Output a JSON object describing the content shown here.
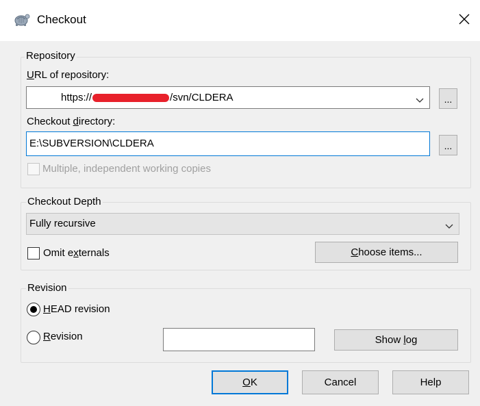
{
  "window": {
    "title": "Checkout",
    "close_label": "✕"
  },
  "repository": {
    "group_label": "Repository",
    "url_label_accel": "U",
    "url_label_rest": "RL of repository:",
    "url_value_prefix": "https://",
    "url_value_suffix": "/svn/CLDERA",
    "browse_label": "...",
    "dir_label_pre": "Checkout ",
    "dir_label_accel": "d",
    "dir_label_post": "irectory:",
    "dir_value": "E:\\SUBVERSION\\CLDERA",
    "multiple_label": "Multiple, independent working copies"
  },
  "depth": {
    "group_label": "Checkout Depth",
    "selected": "Fully recursive",
    "omit_pre": "Omit e",
    "omit_accel": "x",
    "omit_post": "ternals",
    "choose_accel": "C",
    "choose_rest": "hoose items..."
  },
  "revision": {
    "group_label": "Revision",
    "head_accel": "H",
    "head_rest": "EAD revision",
    "rev_accel": "R",
    "rev_rest": "evision",
    "rev_value": "",
    "showlog_pre": "Show ",
    "showlog_accel": "l",
    "showlog_post": "og"
  },
  "footer": {
    "ok_accel": "O",
    "ok_rest": "K",
    "cancel": "Cancel",
    "help": "Help"
  },
  "colors": {
    "accent": "#0078d7",
    "redaction": "#e8212b"
  }
}
